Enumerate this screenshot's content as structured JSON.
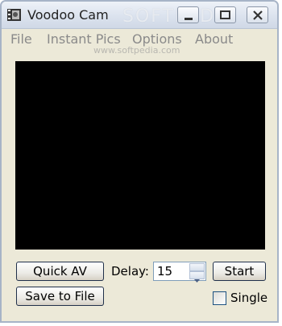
{
  "window": {
    "title": "Voodoo Cam",
    "watermark": "SOFTPEDIA",
    "icon": "film-strip-icon"
  },
  "titlebar_buttons": [
    "minimize-icon",
    "restore-icon",
    "close-icon"
  ],
  "menu": {
    "items": [
      "File",
      "Instant Pics",
      "Options",
      "About"
    ],
    "watermark_url": "www.softpedia.com"
  },
  "preview": {
    "background": "#000000"
  },
  "controls": {
    "quick_av_label": "Quick AV",
    "save_label": "Save to File",
    "delay_label": "Delay:",
    "delay_value": "15",
    "start_label": "Start",
    "single_label": "Single",
    "single_checked": false
  },
  "colors": {
    "window_bg": "#ece9d8",
    "button_border": "#20304a",
    "menu_text": "#8a8a8a"
  }
}
